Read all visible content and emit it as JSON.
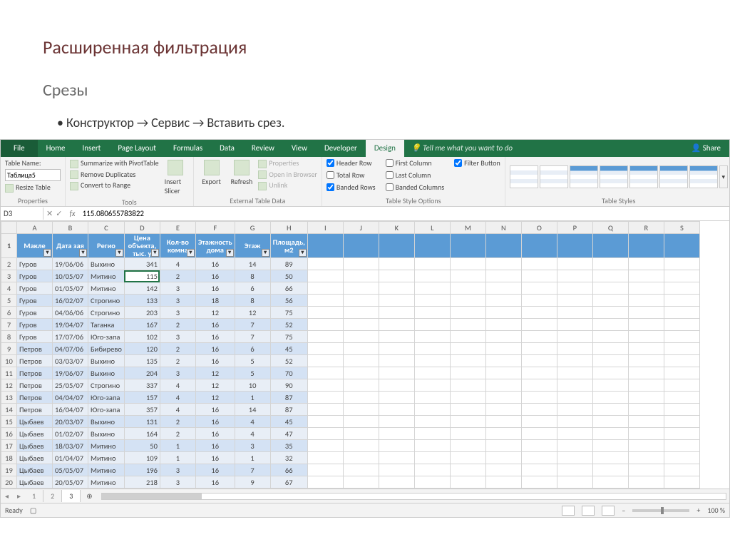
{
  "slide": {
    "title": "Расширенная фильтрация",
    "subtitle": "Срезы",
    "bullet_parts": [
      "Конструктор",
      "Сервис",
      "Вставить срез."
    ]
  },
  "ribbon": {
    "tabs": [
      "File",
      "Home",
      "Insert",
      "Page Layout",
      "Formulas",
      "Data",
      "Review",
      "View",
      "Developer",
      "Design"
    ],
    "active_tab": "Design",
    "tellme": "Tell me what you want to do",
    "share": "Share",
    "groups": {
      "properties": {
        "label": "Properties",
        "table_name_label": "Table Name:",
        "table_name_value": "Таблица5",
        "resize": "Resize Table"
      },
      "tools": {
        "label": "Tools",
        "summarize": "Summarize with PivotTable",
        "remove_dup": "Remove Duplicates",
        "convert": "Convert to Range",
        "slicer": "Insert Slicer"
      },
      "external": {
        "label": "External Table Data",
        "export": "Export",
        "refresh": "Refresh",
        "properties": "Properties",
        "open_browser": "Open in Browser",
        "unlink": "Unlink"
      },
      "style_opts": {
        "label": "Table Style Options",
        "header_row": "Header Row",
        "total_row": "Total Row",
        "banded_rows": "Banded Rows",
        "first_col": "First Column",
        "last_col": "Last Column",
        "banded_cols": "Banded Columns",
        "filter_btn": "Filter Button"
      },
      "styles": {
        "label": "Table Styles"
      }
    }
  },
  "formula_bar": {
    "cell_ref": "D3",
    "fx_label": "fx",
    "value": "115.080655783822"
  },
  "columns": [
    "A",
    "B",
    "C",
    "D",
    "E",
    "F",
    "G",
    "H",
    "I",
    "J",
    "K",
    "L",
    "M",
    "N",
    "O",
    "P",
    "Q",
    "R",
    "S"
  ],
  "table_headers": [
    "Макле",
    "Дата зая",
    "Регио",
    "Цена объекта, тыс. у",
    "Кол-во комна",
    "Этажность дома",
    "Этаж",
    "Площадь, м2"
  ],
  "selected_cell": {
    "row": 3,
    "col": "D"
  },
  "rows": [
    {
      "n": 2,
      "d": [
        "Гуров",
        "19/06/06",
        "Выхино",
        "341",
        "4",
        "16",
        "14",
        "89"
      ]
    },
    {
      "n": 3,
      "d": [
        "Гуров",
        "10/05/07",
        "Митино",
        "115",
        "2",
        "16",
        "8",
        "50"
      ]
    },
    {
      "n": 4,
      "d": [
        "Гуров",
        "01/05/07",
        "Митино",
        "142",
        "3",
        "16",
        "6",
        "66"
      ]
    },
    {
      "n": 5,
      "d": [
        "Гуров",
        "16/02/07",
        "Строгино",
        "133",
        "3",
        "18",
        "8",
        "56"
      ]
    },
    {
      "n": 6,
      "d": [
        "Гуров",
        "04/06/06",
        "Строгино",
        "203",
        "3",
        "12",
        "12",
        "75"
      ]
    },
    {
      "n": 7,
      "d": [
        "Гуров",
        "19/04/07",
        "Таганка",
        "167",
        "2",
        "16",
        "7",
        "52"
      ]
    },
    {
      "n": 8,
      "d": [
        "Гуров",
        "17/07/06",
        "Юго-запа",
        "102",
        "3",
        "16",
        "7",
        "75"
      ]
    },
    {
      "n": 9,
      "d": [
        "Петров",
        "04/07/06",
        "Бибирево",
        "120",
        "2",
        "16",
        "6",
        "45"
      ]
    },
    {
      "n": 10,
      "d": [
        "Петров",
        "03/03/07",
        "Выхино",
        "135",
        "2",
        "16",
        "5",
        "52"
      ]
    },
    {
      "n": 11,
      "d": [
        "Петров",
        "19/06/07",
        "Выхино",
        "204",
        "3",
        "12",
        "5",
        "70"
      ]
    },
    {
      "n": 12,
      "d": [
        "Петров",
        "25/05/07",
        "Строгино",
        "337",
        "4",
        "12",
        "10",
        "90"
      ]
    },
    {
      "n": 13,
      "d": [
        "Петров",
        "04/04/07",
        "Юго-запа",
        "157",
        "4",
        "12",
        "1",
        "87"
      ]
    },
    {
      "n": 14,
      "d": [
        "Петров",
        "16/04/07",
        "Юго-запа",
        "357",
        "4",
        "16",
        "14",
        "87"
      ]
    },
    {
      "n": 15,
      "d": [
        "Цыбаев",
        "20/03/07",
        "Выхино",
        "131",
        "2",
        "16",
        "4",
        "45"
      ]
    },
    {
      "n": 16,
      "d": [
        "Цыбаев",
        "01/02/07",
        "Выхино",
        "164",
        "2",
        "16",
        "4",
        "47"
      ]
    },
    {
      "n": 17,
      "d": [
        "Цыбаев",
        "18/03/07",
        "Митино",
        "50",
        "1",
        "16",
        "3",
        "35"
      ]
    },
    {
      "n": 18,
      "d": [
        "Цыбаев",
        "01/04/07",
        "Митино",
        "109",
        "1",
        "16",
        "1",
        "32"
      ]
    },
    {
      "n": 19,
      "d": [
        "Цыбаев",
        "05/05/07",
        "Митино",
        "196",
        "3",
        "16",
        "7",
        "66"
      ]
    },
    {
      "n": 20,
      "d": [
        "Цыбаев",
        "20/05/07",
        "Митино",
        "218",
        "3",
        "16",
        "9",
        "67"
      ]
    }
  ],
  "sheet_tabs": {
    "tabs": [
      "1",
      "2",
      "3"
    ],
    "active": "3"
  },
  "status_bar": {
    "ready": "Ready",
    "zoom": "100 %",
    "plus": "+",
    "minus": "–"
  }
}
